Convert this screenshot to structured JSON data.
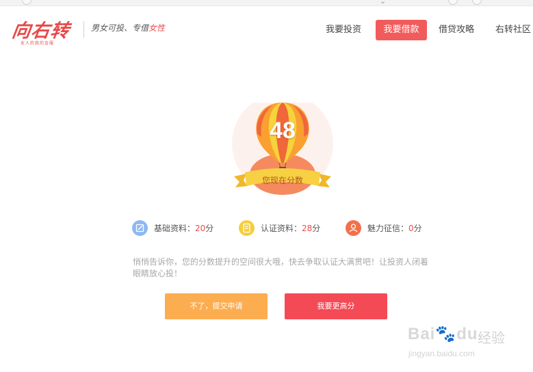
{
  "brand": {
    "logo_text": "向右转",
    "logo_sub": "女人的我的金服",
    "slogan_prefix": "男女可投、专借",
    "slogan_highlight": "女性"
  },
  "nav": {
    "items": [
      {
        "label": "我要投资",
        "active": false
      },
      {
        "label": "我要借款",
        "active": true
      },
      {
        "label": "借贷攻略",
        "active": false
      },
      {
        "label": "右转社区",
        "active": false
      }
    ]
  },
  "score": {
    "value": "48",
    "label": "您现在分数"
  },
  "stats": {
    "items": [
      {
        "label": "基础资料：",
        "value": "20",
        "unit": "分",
        "icon": "edit-icon",
        "color": "#8fb8f2"
      },
      {
        "label": "认证资料：",
        "value": "28",
        "unit": "分",
        "icon": "document-icon",
        "color": "#f6cd3f"
      },
      {
        "label": "魅力征信：",
        "value": "0",
        "unit": "分",
        "icon": "user-icon",
        "color": "#f3704a"
      }
    ]
  },
  "tip": {
    "text": "悄悄告诉你，您的分数提升的空间很大哦，快去争取认证大满贯吧！让投资人闭着眼睛放心投！"
  },
  "actions": {
    "submit_label": "不了，提交申请",
    "improve_label": "我要更高分"
  },
  "colors": {
    "brand": "#e84a4a",
    "nav_active": "#f25b5b",
    "submit_button": "#fcad50",
    "improve_button": "#f44a56",
    "stat_value": "#f04848"
  },
  "watermark": {
    "main": "Bai",
    "paw": "du",
    "jingyan": "经验",
    "url": "jingyan.baidu.com"
  }
}
